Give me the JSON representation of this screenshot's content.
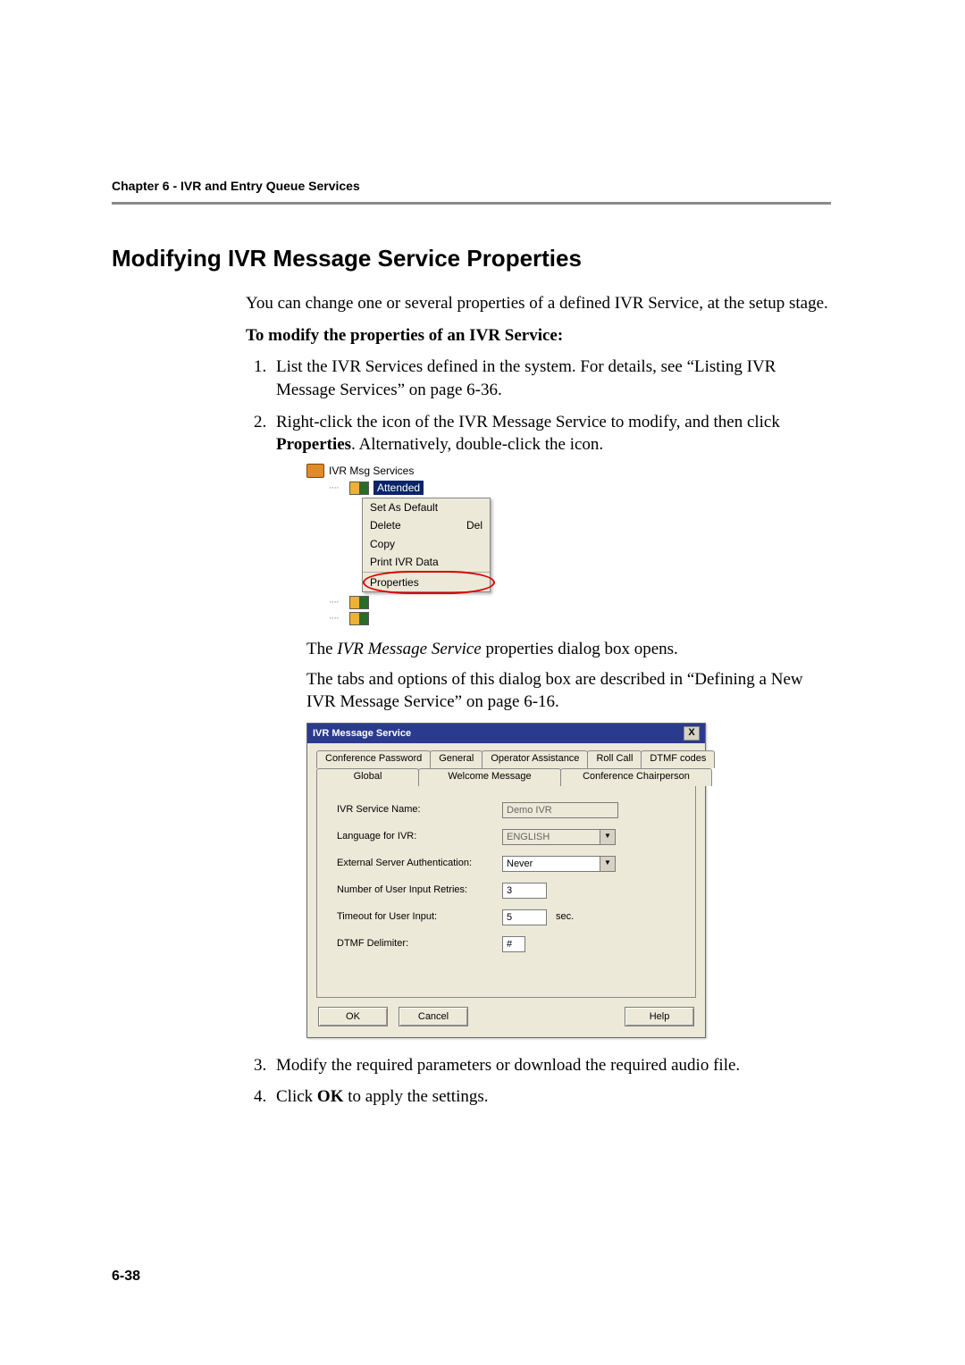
{
  "chapter": "Chapter 6 - IVR and Entry Queue Services",
  "title": "Modifying IVR Message Service Properties",
  "intro": "You can change one or several properties of a defined IVR Service, at the setup stage.",
  "subhead": "To modify the properties of an IVR Service:",
  "steps": {
    "s1": "List the IVR Services defined in the system. For details, see “Listing IVR Message Services” on page 6-36.",
    "s2_a": "Right-click the icon of the IVR Message Service to modify, and then click ",
    "s2_bold": "Properties",
    "s2_b": ". Alternatively, double-click the icon.",
    "after2_a_pre": "The ",
    "after2_a_italic": "IVR Message Service",
    "after2_a_post": " properties dialog box opens.",
    "after2_b": "The tabs and options of this dialog box are described in “Defining a New IVR Message Service” on page 6-16.",
    "s3": "Modify the required parameters or download the required audio file.",
    "s4_a": "Click ",
    "s4_bold": "OK",
    "s4_b": " to apply the settings."
  },
  "tree": {
    "root": "IVR Msg Services",
    "selected": "Attended"
  },
  "ctxmenu": {
    "set_default": "Set As Default",
    "delete": "Delete",
    "delete_key": "Del",
    "copy": "Copy",
    "print": "Print IVR Data",
    "properties": "Properties"
  },
  "dialog": {
    "title": "IVR Message Service",
    "close": "X",
    "tabs_row1": [
      "Conference Password",
      "General",
      "Operator Assistance",
      "Roll Call",
      "DTMF codes"
    ],
    "tabs_row2": [
      "Global",
      "Welcome Message",
      "Conference Chairperson"
    ],
    "form": {
      "service_name_label": "IVR Service Name:",
      "service_name_value": "Demo IVR",
      "language_label": "Language for IVR:",
      "language_value": "ENGLISH",
      "ext_auth_label": "External Server Authentication:",
      "ext_auth_value": "Never",
      "retries_label": "Number of User Input Retries:",
      "retries_value": "3",
      "timeout_label": "Timeout for User Input:",
      "timeout_value": "5",
      "timeout_unit": "sec.",
      "delimiter_label": "DTMF Delimiter:",
      "delimiter_value": "#"
    },
    "buttons": {
      "ok": "OK",
      "cancel": "Cancel",
      "help": "Help"
    }
  },
  "page_number": "6-38"
}
